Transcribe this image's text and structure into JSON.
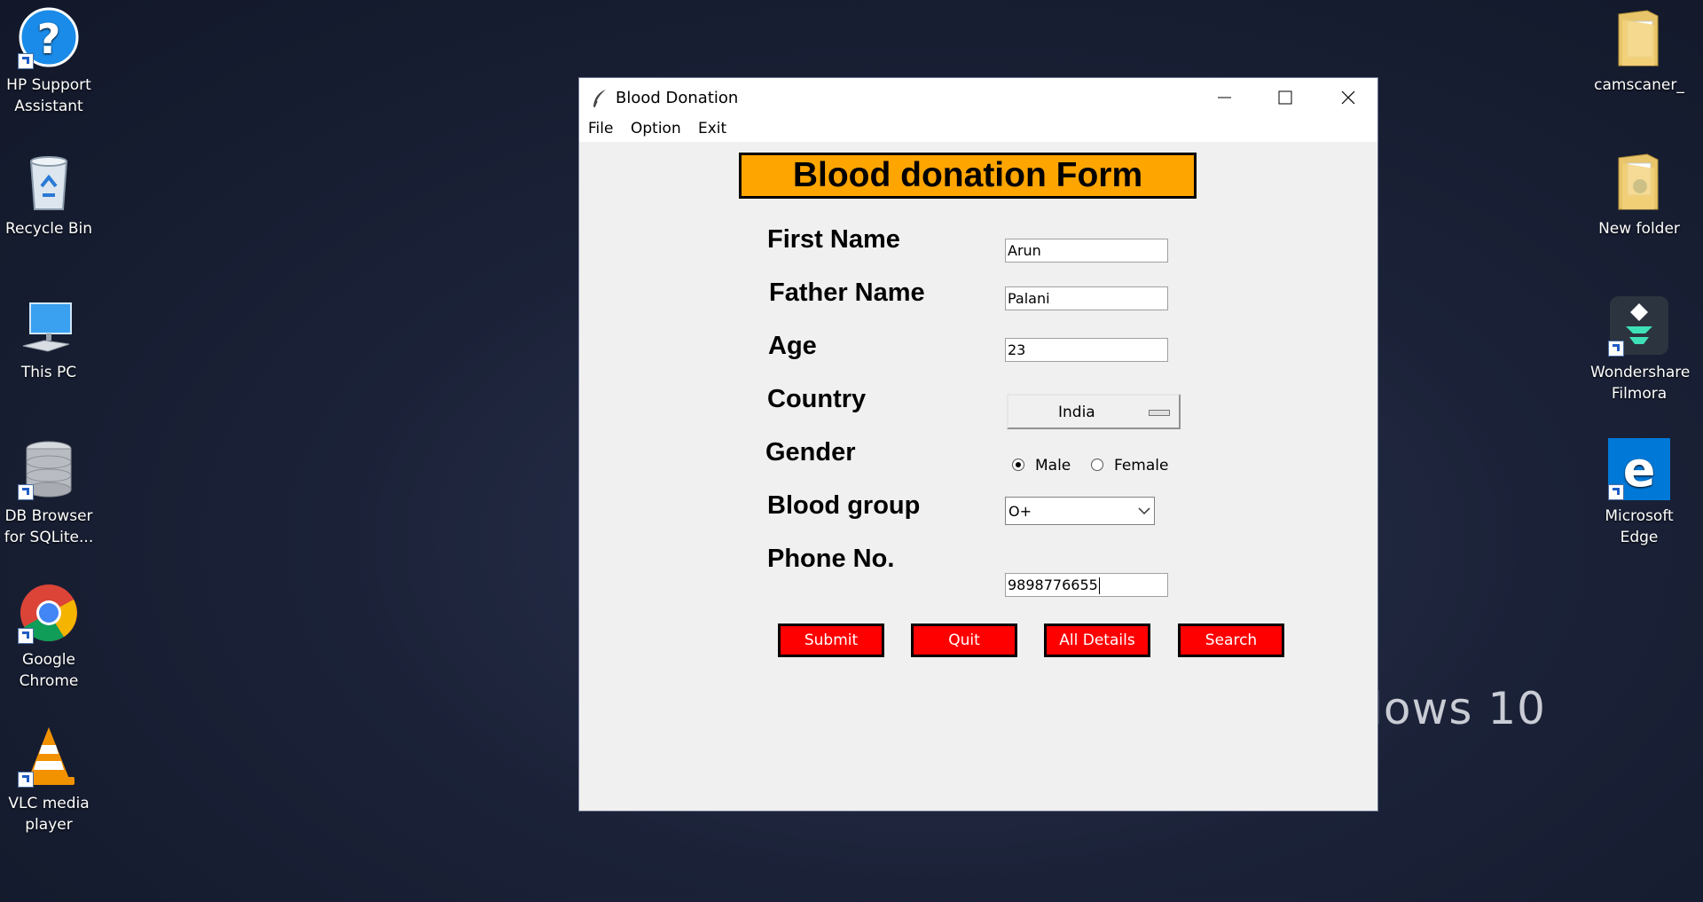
{
  "desktop": {
    "wallpaper_text": "lows 10",
    "left_icons": [
      {
        "label": "HP Support Assistant",
        "icon": "help-icon"
      },
      {
        "label": "Recycle Bin",
        "icon": "recycle-bin-icon"
      },
      {
        "label": "This PC",
        "icon": "computer-icon"
      },
      {
        "label": "DB Browser for SQLite...",
        "icon": "database-icon"
      },
      {
        "label": "Google Chrome",
        "icon": "chrome-icon"
      },
      {
        "label": "VLC media player",
        "icon": "vlc-icon"
      }
    ],
    "right_icons": [
      {
        "label": "camscaner_",
        "icon": "folder-icon"
      },
      {
        "label": "New folder",
        "icon": "folder-icon"
      },
      {
        "label": "Wondershare Filmora",
        "icon": "filmora-icon"
      },
      {
        "label": "Microsoft Edge",
        "icon": "edge-icon"
      }
    ]
  },
  "window": {
    "title": "Blood Donation",
    "menu": [
      "File",
      "Option",
      "Exit"
    ],
    "banner": "Blood donation Form",
    "labels": {
      "first_name": "First Name",
      "father_name": "Father Name",
      "age": "Age",
      "country": "Country",
      "gender": "Gender",
      "blood_group": "Blood group",
      "phone": "Phone No."
    },
    "values": {
      "first_name": "Arun",
      "father_name": "Palani",
      "age": "23",
      "country": "India",
      "blood_group": "O+",
      "phone": "9898776655"
    },
    "gender_options": [
      {
        "label": "Male",
        "selected": true
      },
      {
        "label": "Female",
        "selected": false
      }
    ],
    "buttons": {
      "submit": "Submit",
      "quit": "Quit",
      "all_details": "All Details",
      "search": "Search"
    }
  },
  "colors": {
    "banner": "#ffa500",
    "buttons": "#ff0000",
    "button_text": "#ffffff"
  }
}
